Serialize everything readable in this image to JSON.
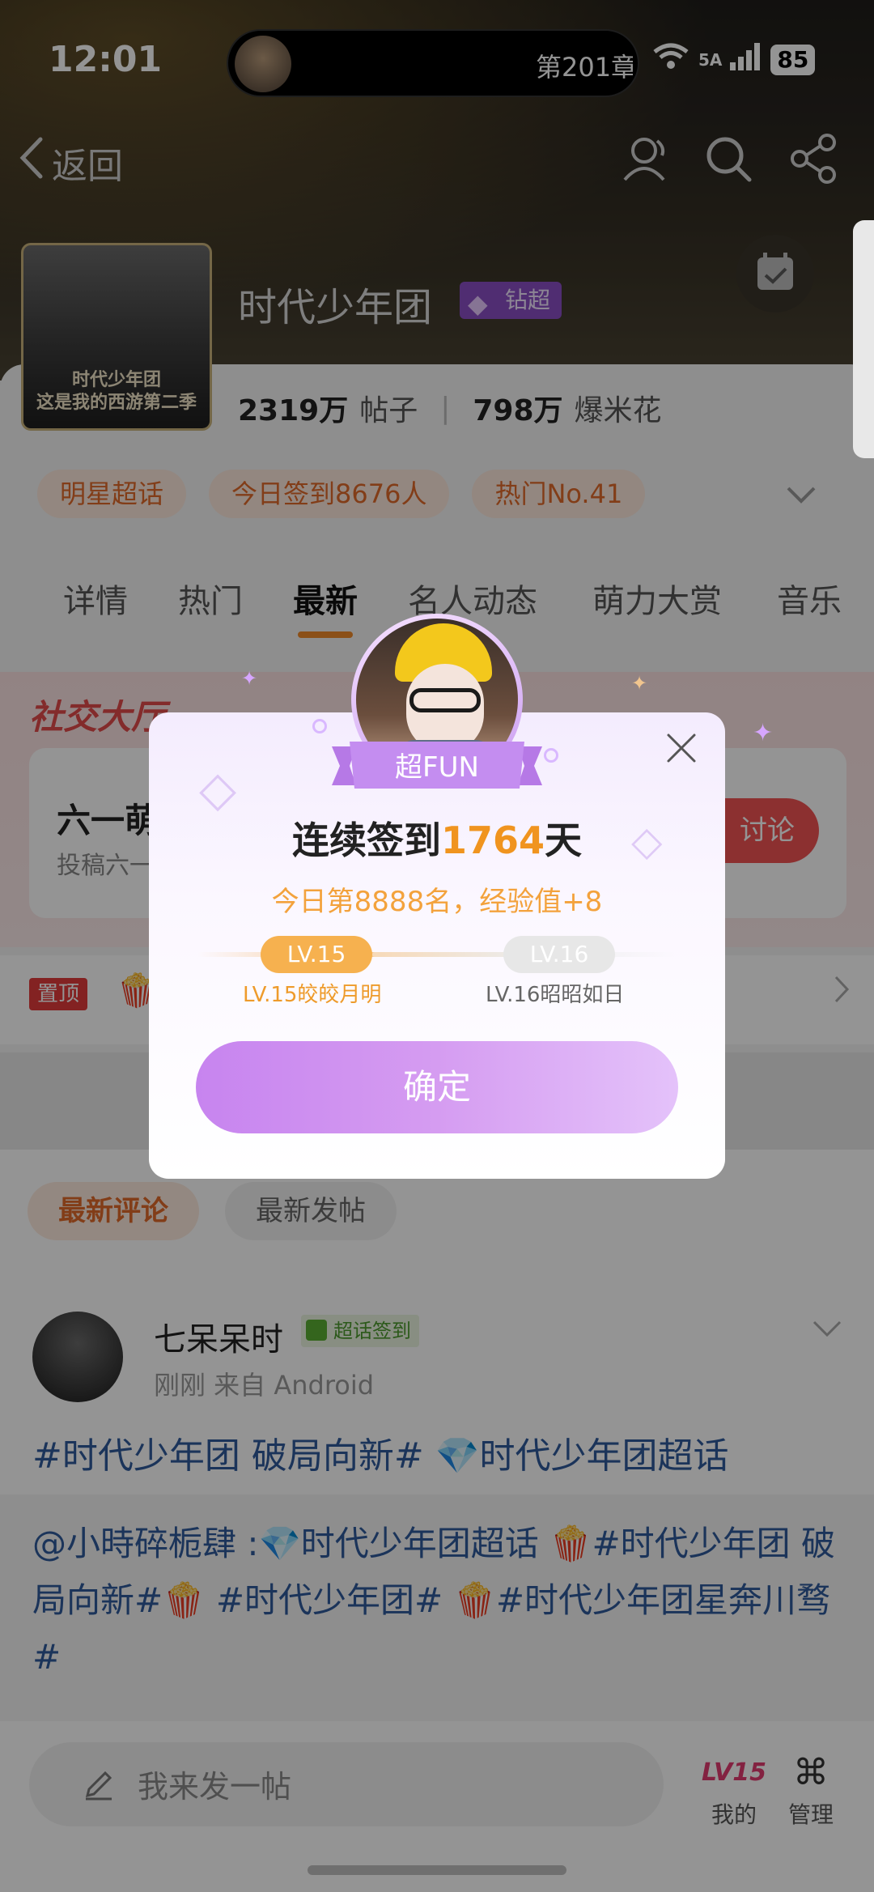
{
  "status_bar": {
    "time": "12:01",
    "live_text": "第201章",
    "battery": "85",
    "network": "5A"
  },
  "nav": {
    "back_label": "返回"
  },
  "forum": {
    "cover_caption_1": "时代少年团",
    "cover_caption_2": "这是我的西游第二季",
    "title": "时代少年团",
    "badge": "钻超",
    "posts_count": "2319万",
    "posts_label": "帖子",
    "popcorn_count": "798万",
    "popcorn_label": "爆米花"
  },
  "chips": [
    "明星超话",
    "今日签到8676人",
    "热门No.41"
  ],
  "tabs": [
    "详情",
    "热门",
    "最新",
    "名人动态",
    "萌力大赏",
    "音乐"
  ],
  "active_tab": "最新",
  "social": {
    "title": "社交大厅",
    "headline": "六一萌",
    "subline": "投稿六一",
    "discuss_label": "讨论"
  },
  "pinned": {
    "badge": "置顶"
  },
  "feed": {
    "sub_tabs": [
      "最新评论",
      "最新发帖"
    ],
    "post": {
      "username": "七呆呆时",
      "badge": "超话签到",
      "meta": "刚刚  来自 Android",
      "title": "#时代少年团 破局向新# 💎时代少年团超话",
      "body": "@小時碎栀肆 :💎时代少年团超话 🍿#时代少年团 破局向新#🍿 #时代少年团# 🍿#时代少年团星奔川骛#"
    }
  },
  "bottom_bar": {
    "compose_placeholder": "我来发一帖",
    "mine_badge": "LV15",
    "mine_label": "我的",
    "manage_label": "管理"
  },
  "modal": {
    "ribbon": "超FUN",
    "title_prefix": "连续签到",
    "days": "1764",
    "title_suffix": "天",
    "subtitle": "今日第8888名，经验值+8",
    "current_level_pill": "LV.15",
    "next_level_pill": "LV.16",
    "current_level_caption": "LV.15皎皎月明",
    "next_level_caption": "LV.16昭昭如日",
    "confirm_label": "确定"
  },
  "colors": {
    "accent_orange": "#f08a2a",
    "purple": "#c784ef",
    "link_blue": "#2f5b9c",
    "red": "#e23c3c"
  }
}
